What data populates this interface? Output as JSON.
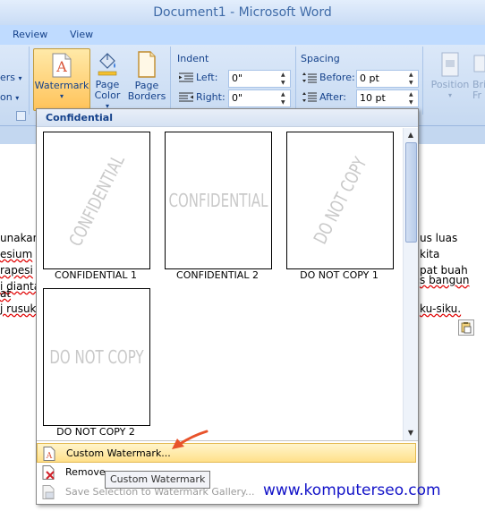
{
  "window": {
    "title": "Document1 - Microsoft Word"
  },
  "tabs": [
    {
      "label": "Review"
    },
    {
      "label": "View"
    }
  ],
  "ribbon": {
    "left_cut": {
      "row1": "ers",
      "row1_arrow": "▾",
      "row2": "on",
      "row2_arrow": "▾"
    },
    "watermark_label": "Watermark",
    "watermark_arrow": "▾",
    "page_color_label_1": "Page",
    "page_color_label_2": "Color",
    "page_color_arrow": "▾",
    "page_borders_label_1": "Page",
    "page_borders_label_2": "Borders",
    "indent": {
      "title": "Indent",
      "left_label": "Left:",
      "left_value": "0\"",
      "right_label": "Right:",
      "right_value": "0\""
    },
    "spacing": {
      "title": "Spacing",
      "before_label": "Before:",
      "before_value": "0 pt",
      "after_label": "After:",
      "after_value": "10 pt"
    },
    "position_label": "Position",
    "position_arrow": "▾",
    "bring_label_1": "Bri",
    "bring_label_2": "Fr"
  },
  "document": {
    "left_lines": [
      "unakan",
      "esium",
      "rapesi",
      "i dianta",
      "at",
      "j rusuk"
    ],
    "right_lines": [
      "us luas",
      "kita",
      "pat buah",
      "s bangun",
      "",
      "ku-siku."
    ]
  },
  "dropdown": {
    "header": "Confidential",
    "scroll_up": "▲",
    "scroll_down": "▼",
    "thumbnails": [
      {
        "text": "CONFIDENTIAL",
        "label": "CONFIDENTIAL 1"
      },
      {
        "text": "CONFIDENTIAL",
        "label": "CONFIDENTIAL 2"
      },
      {
        "text": "DO NOT COPY",
        "label": "DO NOT COPY 1"
      },
      {
        "text": "DO NOT COPY",
        "label": "DO NOT COPY 2"
      }
    ],
    "menu": [
      {
        "label": "Custom Watermark...",
        "state": "hover"
      },
      {
        "label": "Remove",
        "state": "normal"
      },
      {
        "label": "Save Selection to Watermark Gallery...",
        "state": "disabled"
      }
    ]
  },
  "tooltip": "Custom Watermark",
  "overlay_url": "www.komputerseo.com",
  "colors": {
    "accent_text": "#15428b",
    "ribbon_bg": "#c6d9f1",
    "hover_bg": "#ffe08a",
    "watermark_gray": "#c9c9c9",
    "url_blue": "#1212c8",
    "arrow_red": "#e8532b"
  }
}
